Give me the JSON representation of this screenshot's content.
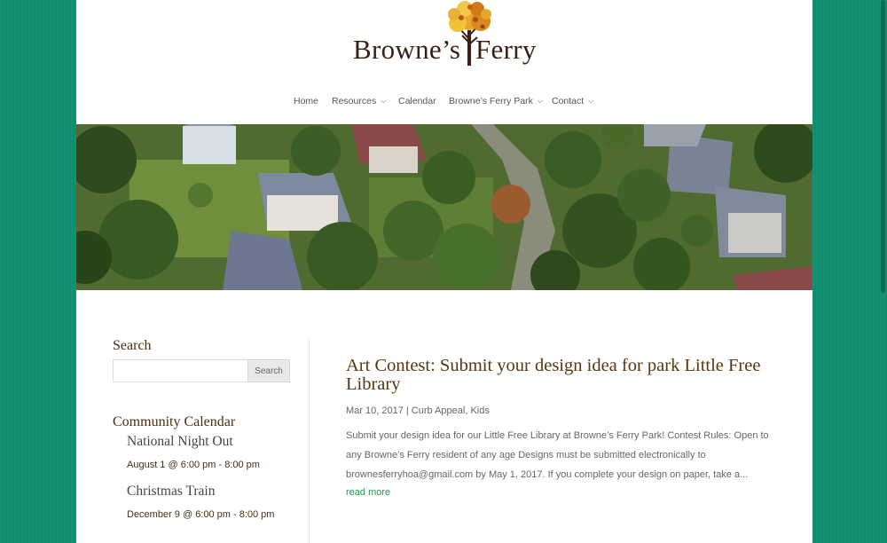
{
  "site": {
    "logo_left": "Browne’s",
    "logo_right": "Ferry"
  },
  "nav": [
    {
      "label": "Home",
      "has_dropdown": false
    },
    {
      "label": "Resources",
      "has_dropdown": true
    },
    {
      "label": "Calendar",
      "has_dropdown": false
    },
    {
      "label": "Browne’s Ferry Park",
      "has_dropdown": true
    },
    {
      "label": "Contact",
      "has_dropdown": true
    }
  ],
  "sidebar": {
    "search_title": "Search",
    "search_placeholder": "",
    "search_button": "Search",
    "calendar_title": "Community Calendar",
    "events": [
      {
        "title": "National Night Out",
        "time": "August 1 @ 6:00 pm - 8:00 pm"
      },
      {
        "title": "Christmas Train",
        "time": "December 9 @ 6:00 pm - 8:00 pm"
      }
    ]
  },
  "post": {
    "title": "Art Contest: Submit your design idea for park Little Free Library",
    "meta": "Mar 10, 2017 | Curb Appeal, Kids",
    "excerpt": "Submit your design idea for our Little Free Library at Browne’s Ferry Park! Contest Rules: Open to any Browne’s Ferry resident of any age Designs must be submitted electronically to brownesferryhoa@gmail.com by May 1, 2017. If you complete your design on paper, take a...",
    "read_more": "read more"
  },
  "colors": {
    "background": "#0f9070",
    "heading": "#4a2e10",
    "link": "#1f9a50"
  },
  "icons": {
    "logo_tree": "autumn-tree-icon",
    "dropdown": "chevron-down-icon"
  }
}
